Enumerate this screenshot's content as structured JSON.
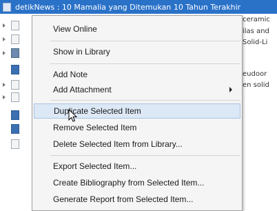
{
  "selected_item": {
    "title": "detikNews : 10 Mamalia yang Ditemukan 10 Tahun Terakhir"
  },
  "right_column": {
    "lines": [
      "ceramic",
      "ilas and",
      "Solid-Li",
      "",
      "eudoor",
      "en solid"
    ]
  },
  "context_menu": {
    "items": [
      {
        "label": "View Online"
      },
      {
        "label": "Show in Library"
      },
      {
        "label": "Add Note"
      },
      {
        "label": "Add Attachment",
        "has_submenu": true
      },
      {
        "label": "Duplicate Selected Item",
        "highlighted": true
      },
      {
        "label": "Remove Selected Item"
      },
      {
        "label": "Delete Selected Item from Library..."
      },
      {
        "label": "Export Selected Item..."
      },
      {
        "label": "Create Bibliography from Selected Item..."
      },
      {
        "label": "Generate Report from Selected Item..."
      }
    ]
  },
  "colors": {
    "selection": "#2a72c8",
    "menu_background": "#f5f5f5",
    "menu_highlight": "#dce8f5"
  },
  "icons": {
    "submenu": "chevron-right-icon",
    "cursor": "mouse-pointer-icon"
  }
}
